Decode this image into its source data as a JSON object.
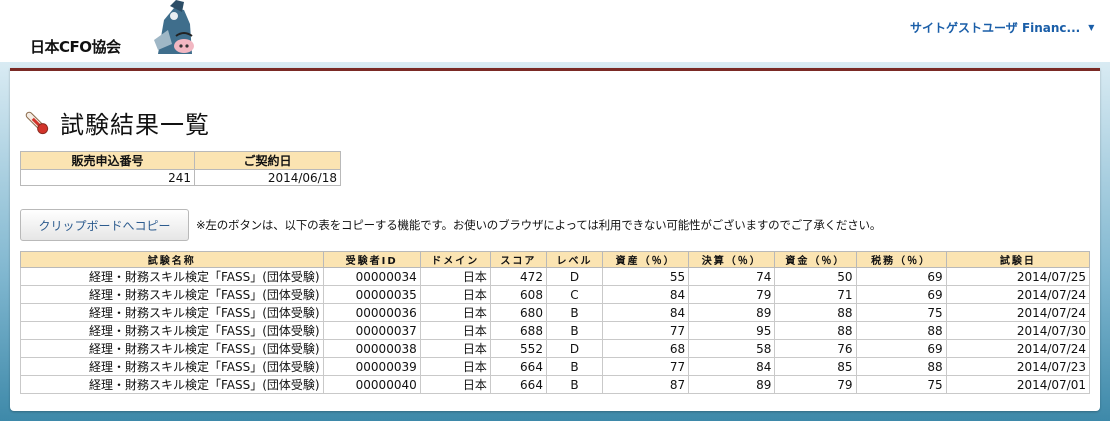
{
  "header": {
    "logo_text": "日本CFO協会",
    "user_menu_label": "サイトゲストユーザ Financ..."
  },
  "page": {
    "title": "試験結果一覧"
  },
  "info": {
    "headers": [
      "販売申込番号",
      "ご契約日"
    ],
    "values": [
      "241",
      "2014/06/18"
    ]
  },
  "copy_button_label": "クリップボードへコピー",
  "note": "※左のボタンは、以下の表をコピーする機能です。お使いのブラウザによっては利用できない可能性がございますのでご了承ください。",
  "results": {
    "headers": [
      "試験名称",
      "受験者ID",
      "ドメイン",
      "スコア",
      "レベル",
      "資産（％）",
      "決算（％）",
      "資金（％）",
      "税務（％）",
      "試験日"
    ],
    "rows": [
      [
        "経理・財務スキル検定「FASS」(団体受験)",
        "00000034",
        "日本",
        "472",
        "D",
        "55",
        "74",
        "50",
        "69",
        "2014/07/25"
      ],
      [
        "経理・財務スキル検定「FASS」(団体受験)",
        "00000035",
        "日本",
        "608",
        "C",
        "84",
        "79",
        "71",
        "69",
        "2014/07/24"
      ],
      [
        "経理・財務スキル検定「FASS」(団体受験)",
        "00000036",
        "日本",
        "680",
        "B",
        "84",
        "89",
        "88",
        "75",
        "2014/07/24"
      ],
      [
        "経理・財務スキル検定「FASS」(団体受験)",
        "00000037",
        "日本",
        "688",
        "B",
        "77",
        "95",
        "88",
        "88",
        "2014/07/30"
      ],
      [
        "経理・財務スキル検定「FASS」(団体受験)",
        "00000038",
        "日本",
        "552",
        "D",
        "68",
        "58",
        "76",
        "69",
        "2014/07/24"
      ],
      [
        "経理・財務スキル検定「FASS」(団体受験)",
        "00000039",
        "日本",
        "664",
        "B",
        "77",
        "84",
        "85",
        "88",
        "2014/07/23"
      ],
      [
        "経理・財務スキル検定「FASS」(団体受験)",
        "00000040",
        "日本",
        "664",
        "B",
        "87",
        "89",
        "79",
        "75",
        "2014/07/01"
      ]
    ]
  },
  "colors": {
    "header_fill": "#fbe4b2",
    "accent_border": "#7a2a25",
    "link": "#1a5ea8"
  }
}
